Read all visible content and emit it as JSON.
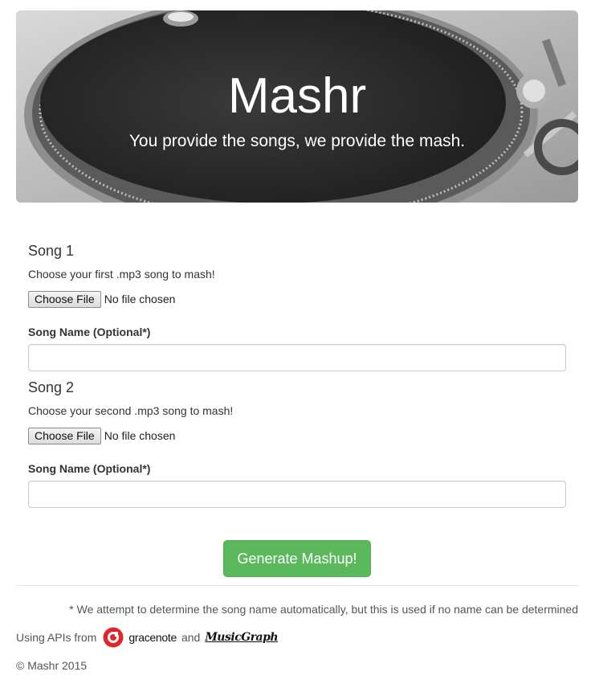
{
  "hero": {
    "title": "Mashr",
    "tagline": "You provide the songs, we provide the mash."
  },
  "song1": {
    "heading": "Song 1",
    "help": "Choose your first .mp3 song to mash!",
    "file_button": "Choose File",
    "file_status": "No file chosen",
    "name_label": "Song Name (Optional*)",
    "name_value": "",
    "name_placeholder": ""
  },
  "song2": {
    "heading": "Song 2",
    "help": "Choose your second .mp3 song to mash!",
    "file_button": "Choose File",
    "file_status": "No file chosen",
    "name_label": "Song Name (Optional*)",
    "name_value": "",
    "name_placeholder": ""
  },
  "submit": {
    "label": "Generate Mashup!"
  },
  "footer": {
    "footnote": "* We attempt to determine the song name automatically, but this is used if no name can be determined",
    "apis_prefix": "Using APIs from",
    "gracenote": "gracenote",
    "and": "and",
    "musicgraph": "MusicGraph",
    "copyright": "© Mashr 2015"
  },
  "colors": {
    "primary_button": "#5cb85c",
    "gracenote_red": "#e0262b"
  },
  "icons": {
    "hero_background": "turntable-image",
    "gracenote_logo": "gracenote-logo-icon"
  }
}
